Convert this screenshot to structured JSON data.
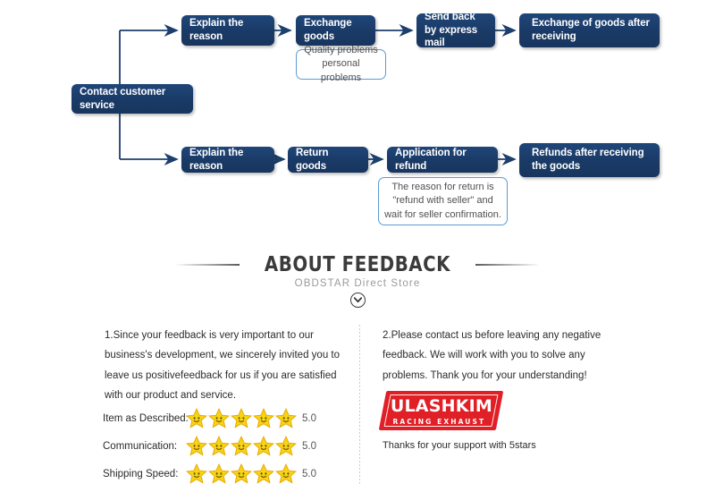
{
  "flowchart": {
    "root": {
      "label": "Contact customer service"
    },
    "branches": [
      {
        "name": "exchange",
        "steps": [
          {
            "label": "Explain the reason"
          },
          {
            "label": "Exchange goods"
          },
          {
            "label": "Send back by express mail"
          },
          {
            "label": "Exchange of goods after receiving"
          }
        ],
        "callout": {
          "lines": [
            "Quality problems",
            "personal problems"
          ]
        }
      },
      {
        "name": "refund",
        "steps": [
          {
            "label": "Explain the reason"
          },
          {
            "label": "Return goods"
          },
          {
            "label": "Application for refund"
          },
          {
            "label": "Refunds after receiving the goods"
          }
        ],
        "callout": {
          "lines": [
            "The reason for return is",
            "\"refund with seller\" and",
            "wait for seller confirmation."
          ]
        }
      }
    ],
    "colors": {
      "node_fill": "#1c3f6e",
      "node_text": "#ffffff",
      "callout_border": "#5b9bd5",
      "connector": "#1c3f6e"
    }
  },
  "feedback": {
    "title": "ABOUT FEEDBACK",
    "subtitle": "OBDSTAR Direct Store",
    "chevron_icon": "chevron-down-icon",
    "left_paragraph": "1.Since your feedback is very important to our business's development, we sincerely invited you to leave us positivefeedback for us if you are satisfied with our product and service.",
    "right_paragraph": "2.Please contact us before leaving any negative feedback. We will work with you to solve any problems. Thank you for your understanding!",
    "ratings": [
      {
        "label": "Item as Described:",
        "stars": 5,
        "score": "5.0"
      },
      {
        "label": "Communication:",
        "stars": 5,
        "score": "5.0"
      },
      {
        "label": "Shipping Speed:",
        "stars": 5,
        "score": "5.0"
      }
    ]
  },
  "brand": {
    "name": "ULASHKIM",
    "tagline": "RACING EXHAUST",
    "thanks": "Thanks for your support with 5stars",
    "logo_color": "#e01f26"
  }
}
